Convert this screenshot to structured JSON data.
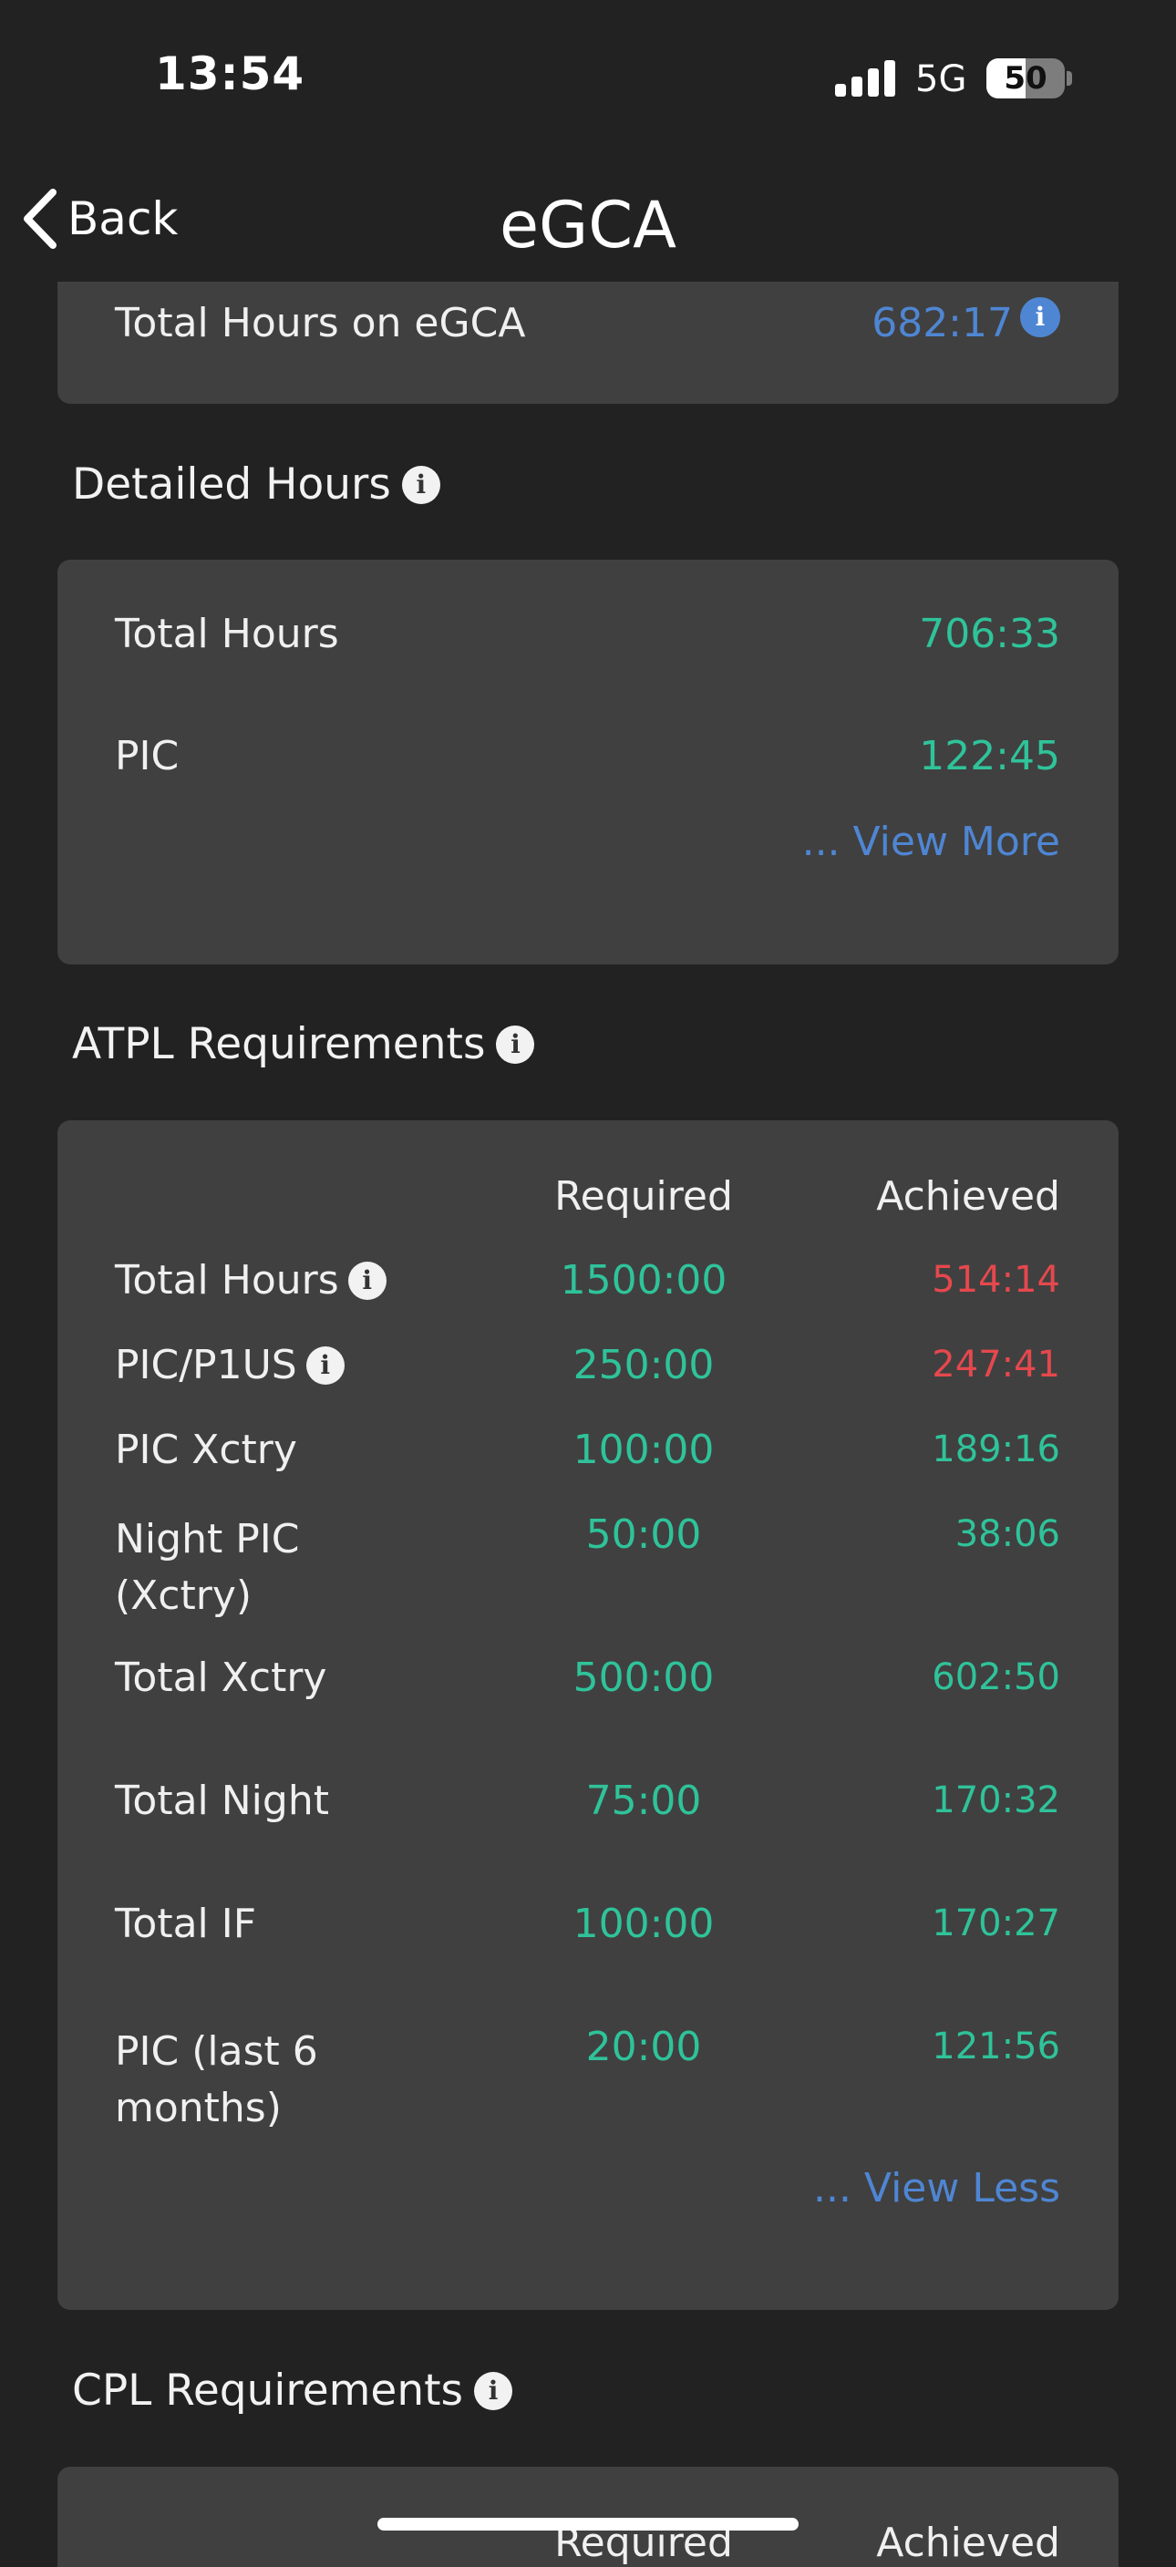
{
  "status_bar": {
    "time": "13:54",
    "network": "5G",
    "battery_level": "50",
    "battery_percent": 50
  },
  "nav": {
    "back_label": "Back",
    "title": "eGCA"
  },
  "egca_card": {
    "label": "Total Hours on eGCA",
    "value": "682:17",
    "info_icon": "i"
  },
  "detailed_hours": {
    "title": "Detailed Hours",
    "info_icon": "i",
    "rows": [
      {
        "label": "Total Hours",
        "value": "706:33"
      },
      {
        "label": "PIC",
        "value": "122:45"
      }
    ],
    "view_more": "... View More"
  },
  "atpl": {
    "title": "ATPL Requirements",
    "info_icon": "i",
    "header_required": "Required",
    "header_achieved": "Achieved",
    "rows": [
      {
        "label": "Total Hours",
        "required": "1500:00",
        "achieved": "514:14",
        "status": "red",
        "has_info": true
      },
      {
        "label": "PIC/P1US",
        "required": "250:00",
        "achieved": "247:41",
        "status": "red",
        "has_info": true
      },
      {
        "label": "PIC Xctry",
        "required": "100:00",
        "achieved": "189:16",
        "status": "teal"
      },
      {
        "label_line1": "Night PIC",
        "label_line2": "(Xctry)",
        "required": "50:00",
        "achieved": "38:06",
        "status": "teal"
      },
      {
        "label": "Total Xctry",
        "required": "500:00",
        "achieved": "602:50",
        "status": "teal"
      },
      {
        "label": "Total Night",
        "required": "75:00",
        "achieved": "170:32",
        "status": "teal"
      },
      {
        "label": "Total IF",
        "required": "100:00",
        "achieved": "170:27",
        "status": "teal"
      },
      {
        "label_line1": "PIC (last 6",
        "label_line2": "months)",
        "required": "20:00",
        "achieved": "121:56",
        "status": "teal"
      }
    ],
    "view_less": "... View Less"
  },
  "cpl": {
    "title": "CPL Requirements",
    "info_icon": "i",
    "header_required": "Required",
    "header_achieved": "Achieved"
  },
  "colors": {
    "background": "#222222",
    "card": "#404040",
    "teal": "#2fc39a",
    "red": "#e5484d",
    "link_blue": "#4f86d3"
  }
}
